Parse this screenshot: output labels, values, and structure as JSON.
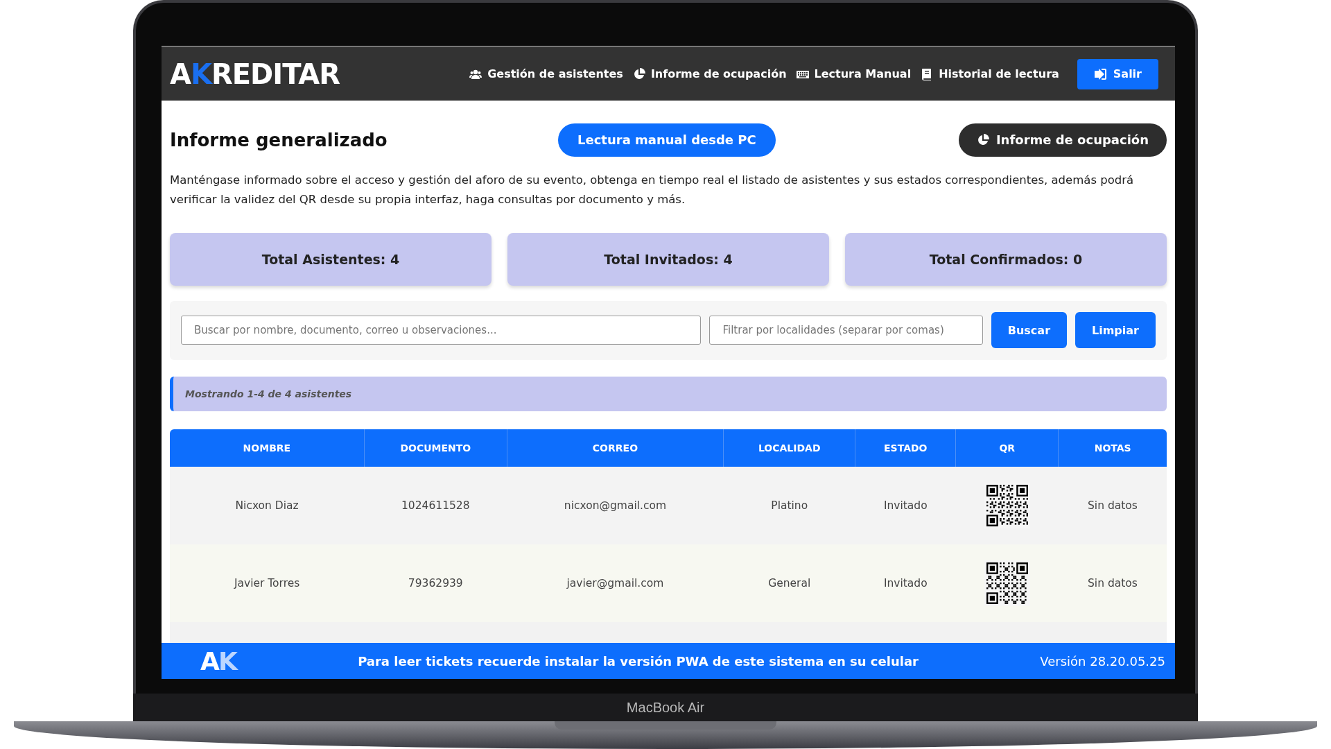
{
  "device": {
    "label": "MacBook Air"
  },
  "header": {
    "logo": {
      "prefix": "A",
      "accent": "K",
      "rest": "REDITAR"
    },
    "nav": [
      {
        "label": "Gestión de asistentes"
      },
      {
        "label": "Informe de ocupación"
      },
      {
        "label": "Lectura Manual"
      },
      {
        "label": "Historial de lectura"
      }
    ],
    "logout": {
      "label": "Salir"
    }
  },
  "page": {
    "title": "Informe generalizado",
    "primary_button": "Lectura manual desde PC",
    "secondary_button": {
      "label": "Informe de ocupación"
    },
    "description": "Manténgase informado sobre el acceso y gestión del aforo de su evento, obtenga en tiempo real el listado de asistentes y sus estados correspondientes, además podrá verificar la validez del QR desde su propia interfaz, haga consultas por documento y más."
  },
  "stats": [
    "Total Asistentes: 4",
    "Total Invitados: 4",
    "Total Confirmados: 0"
  ],
  "filters": {
    "search": {
      "placeholder": "Buscar por nombre, documento, correo u observaciones..."
    },
    "locations": {
      "placeholder": "Filtrar por localidades (separar por comas)"
    },
    "buttons": [
      "Buscar",
      "Limpiar"
    ]
  },
  "info": "Mostrando 1-4 de 4 asistentes",
  "table": {
    "columns": [
      "NOMBRE",
      "DOCUMENTO",
      "CORREO",
      "LOCALIDAD",
      "ESTADO",
      "QR",
      "NOTAS"
    ],
    "rows": [
      {
        "nombre": "Nicxon Diaz",
        "documento": "1024611528",
        "correo": "nicxon@gmail.com",
        "localidad": "Platino",
        "estado": "Invitado",
        "notas": "Sin datos"
      },
      {
        "nombre": "Javier Torres",
        "documento": "79362939",
        "correo": "javier@gmail.com",
        "localidad": "General",
        "estado": "Invitado",
        "notas": "Sin datos"
      }
    ]
  },
  "footer": {
    "logo": {
      "prefix": "A",
      "accent": "K"
    },
    "message": "Para leer tickets recuerde instalar la versión PWA de este sistema en su celular",
    "version": "Versión 28.20.05.25"
  }
}
